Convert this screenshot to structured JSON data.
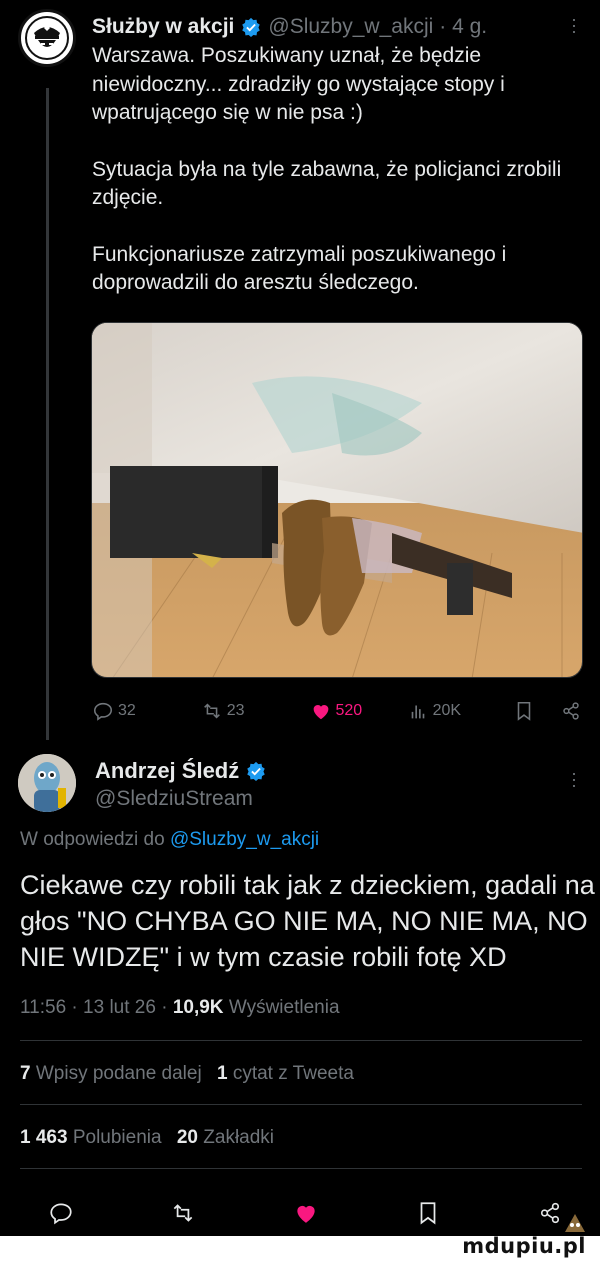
{
  "tweet1": {
    "author_name": "Służby w akcji",
    "handle": "@Sluzby_w_akcji",
    "time_ago": "· 4 g.",
    "paragraphs": [
      "Warszawa. Poszukiwany uznał, że będzie niewidoczny... zdradziły go wystające stopy i wpatrującego się w nie psa :)",
      "Sytuacja była na tyle zabawna, że policjanci zrobili zdjęcie.",
      "Funkcjonariusze zatrzymali poszukiwanego i doprowadzili do aresztu śledczego."
    ],
    "actions": {
      "replies": "32",
      "retweets": "23",
      "likes": "520",
      "views": "20K"
    }
  },
  "tweet2": {
    "author_name": "Andrzej Śledź",
    "handle": "@SledziuStream",
    "reply_prefix": "W odpowiedzi do ",
    "reply_mention": "@Sluzby_w_akcji",
    "text": "Ciekawe czy robili tak jak z dzieckiem, gadali na głos \"NO CHYBA GO NIE MA, NO NIE MA, NO NIE WIDZĘ\" i w tym czasie robili fotę XD",
    "time": "11:56",
    "date": "13 lut 26",
    "views_count": "10,9K",
    "views_label": "Wyświetlenia",
    "quote_tweets_count": "7",
    "quote_tweets_label": "Wpisy podane dalej",
    "quotes_count": "1",
    "quotes_label": "cytat z Tweeta",
    "likes_count": "1 463",
    "likes_label": "Polubienia",
    "bookmarks_count": "20",
    "bookmarks_label": "Zakładki"
  },
  "watermark": "mdupiu.pl",
  "colors": {
    "background": "#000000",
    "text": "#e7e9ea",
    "muted": "#71767b",
    "accent": "#1d9bf0",
    "like": "#f91880"
  },
  "icons": [
    "police-badge-icon",
    "verified-icon",
    "more-icon",
    "reply-icon",
    "retweet-icon",
    "like-icon",
    "views-icon",
    "bookmark-icon",
    "share-icon"
  ]
}
